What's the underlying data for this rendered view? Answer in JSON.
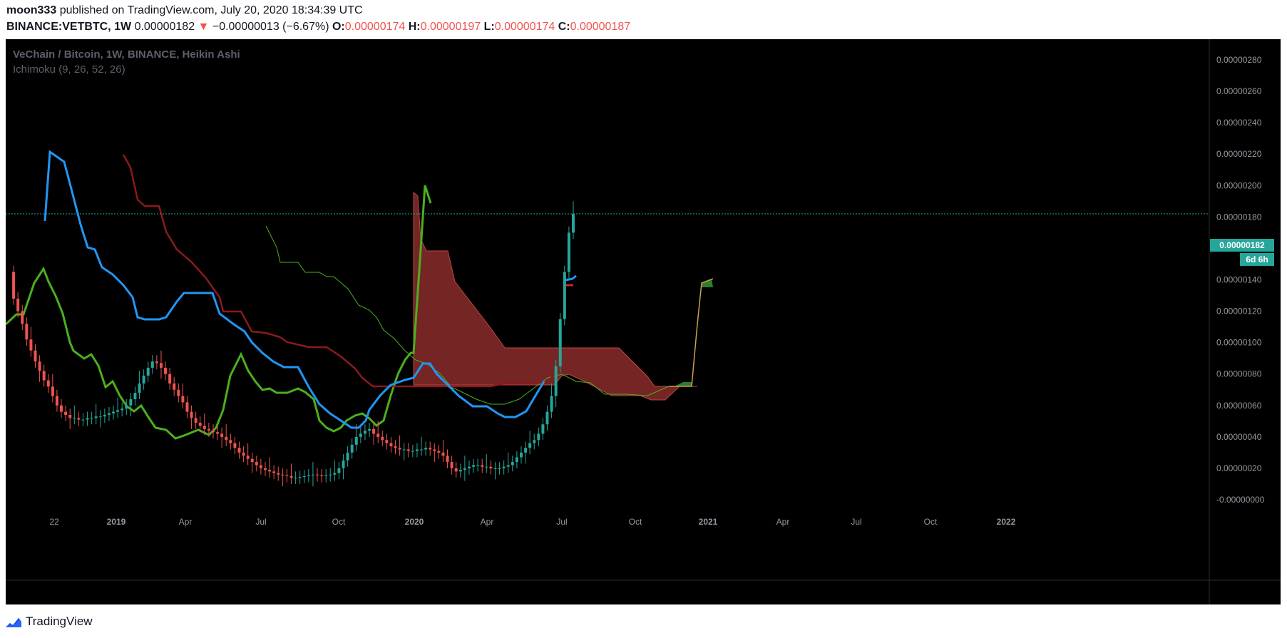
{
  "header": {
    "author": "moon333",
    "published_text": "published on TradingView.com, July 20, 2020 18:34:39 UTC",
    "symbol": "BINANCE:VETBTC, 1W",
    "last_price": "0.00000182",
    "change_arrow": "▼",
    "change": "−0.00000013 (−6.67%)",
    "o_label": "O:",
    "o_value": "0.00000174",
    "h_label": "H:",
    "h_value": "0.00000197",
    "l_label": "L:",
    "l_value": "0.00000174",
    "c_label": "C:",
    "c_value": "0.00000187"
  },
  "legend": {
    "title": "VeChain / Bitcoin, 1W, BINANCE, Heikin Ashi",
    "indicator": "Ichimoku (9, 26, 52, 26)"
  },
  "price_label": {
    "value": "0.00000182",
    "countdown": "6d 6h"
  },
  "footer": {
    "brand": "TradingView"
  },
  "colors": {
    "up": "#26a69a",
    "down": "#ef5350",
    "conversion": "#2196f3",
    "base": "#8b1a1a",
    "lagging": "#4caf1e",
    "lead_a": "#4caf1e",
    "cloud_bear": "#8b2c2c",
    "cloud_bull": "#2e7d32",
    "background": "#000000"
  },
  "chart_data": {
    "type": "candlestick",
    "title": "VeChain / Bitcoin, 1W, BINANCE, Heikin Ashi",
    "y_unit": "BTC",
    "ylim": [
      -0.0,
      2.9e-06
    ],
    "y_ticks": [
      "0.00000280",
      "0.00000260",
      "0.00000240",
      "0.00000220",
      "0.00000200",
      "0.00000180",
      "0.00000160",
      "0.00000140",
      "0.00000120",
      "0.00000100",
      "0.00000080",
      "0.00000060",
      "0.00000040",
      "0.00000020",
      "-0.00000000"
    ],
    "x_ticks": [
      "22",
      "2019",
      "Apr",
      "Jul",
      "Oct",
      "2020",
      "Apr",
      "Jul",
      "Oct",
      "2021",
      "Apr",
      "Jul",
      "Oct",
      "2022"
    ],
    "current_price": 1.82e-06,
    "candles": [
      {
        "o": 1.43,
        "c": 1.17,
        "h": 1.72,
        "l": 1.17
      },
      {
        "o": 1.15,
        "c": 1.46,
        "h": 1.73,
        "l": 1.12
      },
      {
        "o": 1.44,
        "c": 1.28,
        "h": 1.5,
        "l": 0.93
      },
      {
        "o": 1.28,
        "c": 1.21,
        "h": 1.4,
        "l": 1.0
      },
      {
        "o": 1.22,
        "c": 1.12,
        "h": 1.28,
        "l": 0.95
      },
      {
        "o": 1.12,
        "c": 1.05,
        "h": 1.22,
        "l": 0.9
      },
      {
        "o": 1.05,
        "c": 0.98,
        "h": 1.1,
        "l": 0.86
      },
      {
        "o": 0.98,
        "c": 0.92,
        "h": 1.03,
        "l": 0.83
      },
      {
        "o": 0.92,
        "c": 0.85,
        "h": 0.97,
        "l": 0.79
      },
      {
        "o": 0.86,
        "c": 0.82,
        "h": 0.92,
        "l": 0.76
      },
      {
        "o": 0.82,
        "c": 0.76,
        "h": 0.86,
        "l": 0.68
      },
      {
        "o": 0.77,
        "c": 0.72,
        "h": 0.8,
        "l": 0.65
      },
      {
        "o": 0.72,
        "c": 0.66,
        "h": 0.76,
        "l": 0.6
      },
      {
        "o": 0.66,
        "c": 0.58,
        "h": 0.71,
        "l": 0.52
      },
      {
        "o": 0.58,
        "c": 0.5,
        "h": 0.63,
        "l": 0.45
      },
      {
        "o": 0.5,
        "c": 0.43,
        "h": 0.54,
        "l": 0.38
      },
      {
        "o": 0.43,
        "c": 0.4,
        "h": 0.47,
        "l": 0.35
      },
      {
        "o": 0.4,
        "c": 0.37,
        "h": 0.43,
        "l": 0.33
      },
      {
        "o": 0.37,
        "c": 0.34,
        "h": 0.41,
        "l": 0.3
      },
      {
        "o": 0.34,
        "c": 0.3,
        "h": 0.37,
        "l": 0.26
      },
      {
        "o": 0.3,
        "c": 0.29,
        "h": 0.34,
        "l": 0.26
      },
      {
        "o": 0.29,
        "c": 0.27,
        "h": 0.33,
        "l": 0.25
      },
      {
        "o": 0.27,
        "c": 0.26,
        "h": 0.3,
        "l": 0.24
      },
      {
        "o": 0.26,
        "c": 0.28,
        "h": 0.32,
        "l": 0.25
      },
      {
        "o": 0.28,
        "c": 0.28,
        "h": 0.31,
        "l": 0.26
      },
      {
        "o": 0.28,
        "c": 0.27,
        "h": 0.31,
        "l": 0.25
      },
      {
        "o": 0.27,
        "c": 0.28,
        "h": 0.3,
        "l": 0.26
      },
      {
        "o": 0.28,
        "c": 0.29,
        "h": 0.31,
        "l": 0.27
      },
      {
        "o": 0.29,
        "c": 0.28,
        "h": 0.31,
        "l": 0.26
      },
      {
        "o": 0.28,
        "c": 0.28,
        "h": 0.3,
        "l": 0.27
      },
      {
        "o": 0.28,
        "c": 0.3,
        "h": 0.33,
        "l": 0.27
      },
      {
        "o": 0.3,
        "c": 0.35,
        "h": 0.38,
        "l": 0.29
      },
      {
        "o": 0.35,
        "c": 0.4,
        "h": 0.43,
        "l": 0.33
      },
      {
        "o": 0.4,
        "c": 0.45,
        "h": 0.48,
        "l": 0.38
      },
      {
        "o": 0.45,
        "c": 0.5,
        "h": 0.54,
        "l": 0.43
      },
      {
        "o": 0.5,
        "c": 0.47,
        "h": 0.55,
        "l": 0.44
      },
      {
        "o": 0.47,
        "c": 0.43,
        "h": 0.5,
        "l": 0.39
      },
      {
        "o": 0.43,
        "c": 0.36,
        "h": 0.46,
        "l": 0.3
      },
      {
        "o": 0.36,
        "c": 0.3,
        "h": 0.41,
        "l": 0.25
      }
    ],
    "series_note": "Ichimoku lines rendered as overlays"
  }
}
